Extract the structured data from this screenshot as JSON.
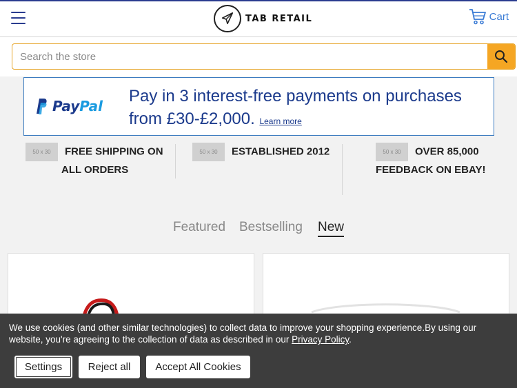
{
  "header": {
    "logo_text": "TAB RETAIL",
    "cart_label": "Cart"
  },
  "search": {
    "placeholder": "Search the store"
  },
  "paypal": {
    "word_a": "Pay",
    "word_b": "Pal",
    "line1": "Pay in 3 interest-free payments on purchases",
    "line2": "from £30-£2,000.",
    "learn_more": "Learn more"
  },
  "features": {
    "placeholder": "50 x 30",
    "shipping_a": "FREE SHIPPING ON",
    "shipping_b": "ALL ORDERS",
    "established": "ESTABLISHED 2012",
    "feedback_a": "OVER 85,000",
    "feedback_b": "FEEDBACK ON EBAY!"
  },
  "tabs": [
    {
      "label": "Featured",
      "active": false
    },
    {
      "label": "Bestselling",
      "active": false
    },
    {
      "label": "New",
      "active": true
    }
  ],
  "cookie": {
    "text": "We use cookies (and other similar technologies) to collect data to improve your shopping experience.By using our website, you're agreeing to the collection of data as described in our",
    "link": "Privacy Policy",
    "end": ".",
    "settings": "Settings",
    "reject": "Reject all",
    "accept": "Accept All Cookies"
  },
  "colors": {
    "brand": "#2a3c8f",
    "search_accent": "#f5a623",
    "cart": "#3a7bd5",
    "paypal_dark": "#1b3a8c",
    "paypal_light": "#1a9be0",
    "cookie_bg": "#3d3d3d"
  }
}
